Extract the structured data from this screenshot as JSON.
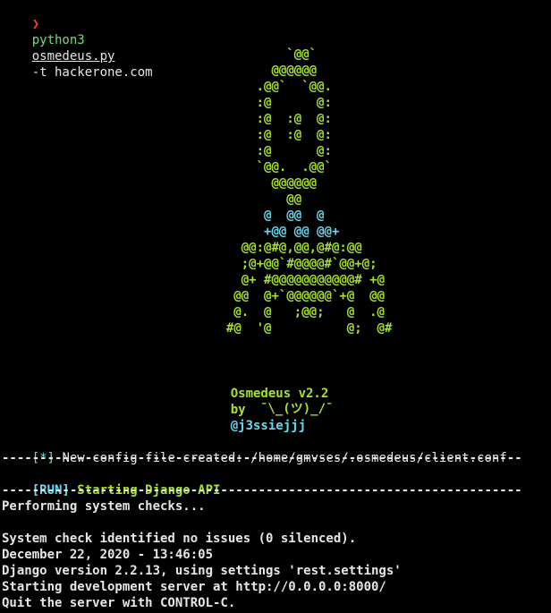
{
  "prompt": {
    "arrow": "❯",
    "cmd": "python3",
    "script": "osmedeus.py",
    "args": "-t hackerone.com"
  },
  "logo_lines": [
    "                                      `@@`",
    "                                    @@@@@@",
    "                                  .@@`  `@@.",
    "                                  :@      @:",
    "                                  :@  :@  @:",
    "                                  :@  :@  @:",
    "                                  :@      @:",
    "                                  `@@.  .@@`",
    "                                    @@@@@@",
    "                                      @@",
    "                                   @  @@  @",
    "                                   +@@ @@ @@+",
    "                                @@:@#@,@@,@#@:@@",
    "                                ;@+@@`#@@@@#`@@+@;",
    "                                @+ #@@@@@@@@@@@# +@",
    "                               @@  @+`@@@@@@`+@  @@",
    "                               @.  @   ;@@;   @  .@",
    "                              #@  '@          @;  @#"
  ],
  "banner": {
    "name": "Osmedeus v2.2",
    "by": "by",
    "author": "@j3ssiejjj",
    "shrug": "¯\\_(ツ)_/¯"
  },
  "lines": {
    "config_tag": "[*]",
    "config_text": " New config file created: /home/gmvses/.osmedeus/client.conf",
    "separator": "---------------------------------------------------------------------",
    "run_tag": "[RUN]",
    "run_text": " Starting Django API",
    "checks": "Performing system checks...",
    "no_issues": "System check identified no issues (0 silenced).",
    "date": "December 22, 2020 - 13:46:05",
    "django": "Django version 2.2.13, using settings 'rest.settings'",
    "server": "Starting development server at http://0.0.0.0:8000/",
    "quit": "Quit the server with CONTROL-C."
  },
  "colors": {
    "background": "#000000",
    "green": "#a6e22e",
    "cyan": "#66d9ef",
    "red": "#ff3b3b",
    "text": "#e6e6e6"
  }
}
